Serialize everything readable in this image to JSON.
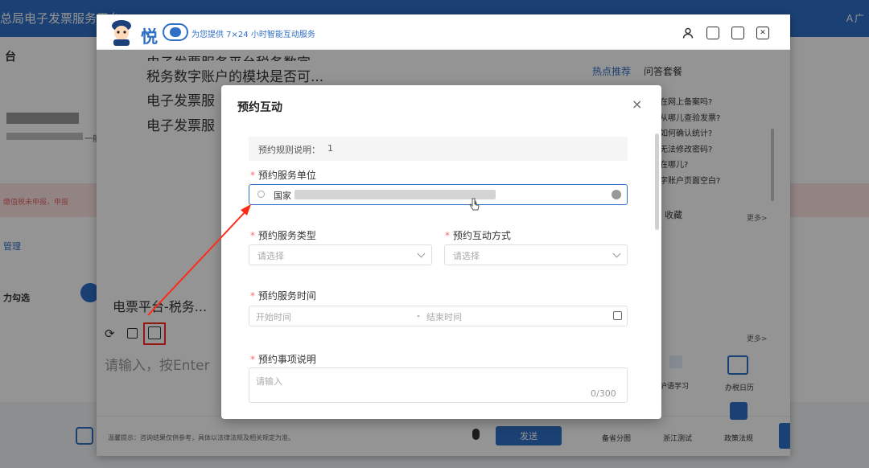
{
  "background": {
    "header_title": "总局电子发票服务平台",
    "header_right": "Ａ广",
    "left_label_1": "台",
    "left_label_2": "缴值税未申报，申报",
    "left_label_3": "管理",
    "left_label_4": "力勾选",
    "mid_text": "一般"
  },
  "chat": {
    "title": "悦",
    "slogan": "为您提供 7×24 小时智能互动服务",
    "faq": [
      "电子发票服务平台税务数字...",
      "税务数字账户的模块是否可...",
      "电子发票服",
      "电子发票服"
    ],
    "mini_line": "电票平台-税务...",
    "input_placeholder": "请输入，按Enter",
    "tip": "温馨提示：咨询结果仅供参考，具体以法律法规及相关规定为准。",
    "send_label": "发送",
    "hot_tab": "热点推荐",
    "qa_tab": "问答套餐",
    "hot_list": [
      "在网上备案吗?",
      "从哪儿查验发票?",
      "如何确认统计?",
      "无法修改密码?",
      "在哪儿?",
      "字账户页面空白?"
    ],
    "collect_label": "收藏",
    "more_label_1": "更多>",
    "more_label_2": "更多>",
    "tool_icons": [
      "沪语学习",
      "办税日历"
    ],
    "bottom_links": [
      "备省分图",
      "浙江测试",
      "政策法规"
    ]
  },
  "modal": {
    "title": "预约互动",
    "rule_label": "预约规则说明：",
    "rule_value": "1",
    "unit_label": "预约服务单位",
    "unit_value": "国家",
    "service_type_label": "预约服务类型",
    "service_type_placeholder": "请选择",
    "mode_label": "预约互动方式",
    "mode_placeholder": "请选择",
    "time_label": "预约服务时间",
    "start_placeholder": "开始时间",
    "end_placeholder": "结束时间",
    "time_sep": "-",
    "desc_label": "预约事项说明",
    "desc_placeholder": "请输入",
    "desc_count": "0/300"
  },
  "colors": {
    "accent": "#2f6fc6",
    "annotation": "#ff2a1a"
  }
}
